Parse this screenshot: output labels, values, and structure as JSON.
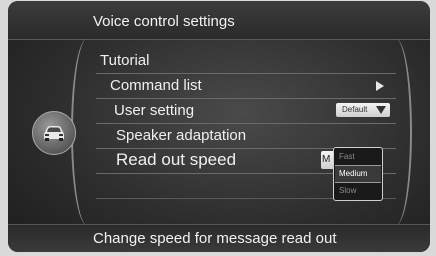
{
  "header": {
    "title": "Voice control settings"
  },
  "menu": {
    "items": [
      {
        "label": "Tutorial"
      },
      {
        "label": "Command list"
      },
      {
        "label": "User setting",
        "value": "Default"
      },
      {
        "label": "Speaker adaptation"
      },
      {
        "label": "Read out speed",
        "value_partial": "M"
      }
    ]
  },
  "dropdown": {
    "options": [
      "Fast",
      "Medium",
      "Slow"
    ],
    "selected": "Medium"
  },
  "footer": {
    "hint": "Change speed for message read out"
  },
  "icons": {
    "car": "car-icon",
    "submenu": "right-arrow-icon",
    "dropdown": "dropdown-arrow-icon"
  }
}
